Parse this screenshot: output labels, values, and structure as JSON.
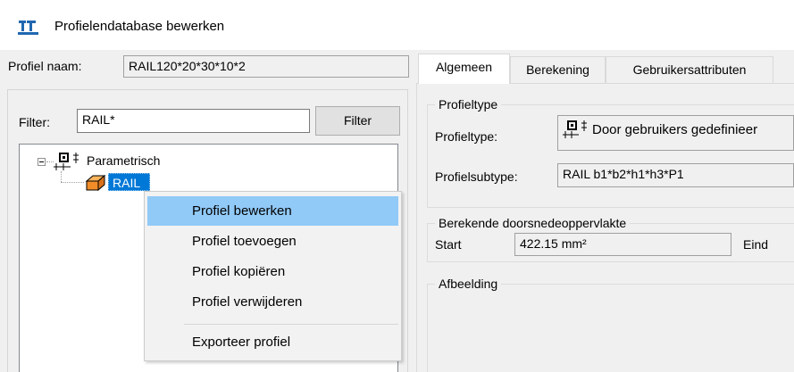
{
  "window": {
    "title": "Profielendatabase bewerken",
    "icon": "app-profile-icon"
  },
  "profile_name": {
    "label": "Profiel naam:",
    "value": "RAIL120*20*30*10*2"
  },
  "filter": {
    "label": "Filter:",
    "value": "RAIL*",
    "button": "Filter"
  },
  "tree": {
    "root": {
      "label": "Parametrisch",
      "icon": "parametric-profile-icon",
      "expanded": true
    },
    "child": {
      "label": "RAIL",
      "icon": "orange-profile-icon",
      "selected": true
    }
  },
  "context_menu": {
    "items": [
      "Profiel bewerken",
      "Profiel toevoegen",
      "Profiel kopiëren",
      "Profiel verwijderen"
    ],
    "export": "Exporteer profiel",
    "hovered_index": 0
  },
  "tabs": [
    "Algemeen",
    "Berekening",
    "Gebruikersattributen"
  ],
  "active_tab": 0,
  "profieltype_group": {
    "title": "Profieltype",
    "type_label": "Profieltype:",
    "type_value": "Door gebruikers gedefinieer",
    "subtype_label": "Profielsubtype:",
    "subtype_value": "RAIL b1*b2*h1*h3*P1"
  },
  "area_group": {
    "title": "Berekende doorsnedeoppervlakte",
    "start_label": "Start",
    "start_value": "422.15 mm²",
    "end_label": "Eind"
  },
  "image_group": {
    "title": "Afbeelding"
  },
  "colors": {
    "selection": "#0078d7",
    "menu_hover": "#91c9f7",
    "profile_orange": "#f28c28"
  }
}
